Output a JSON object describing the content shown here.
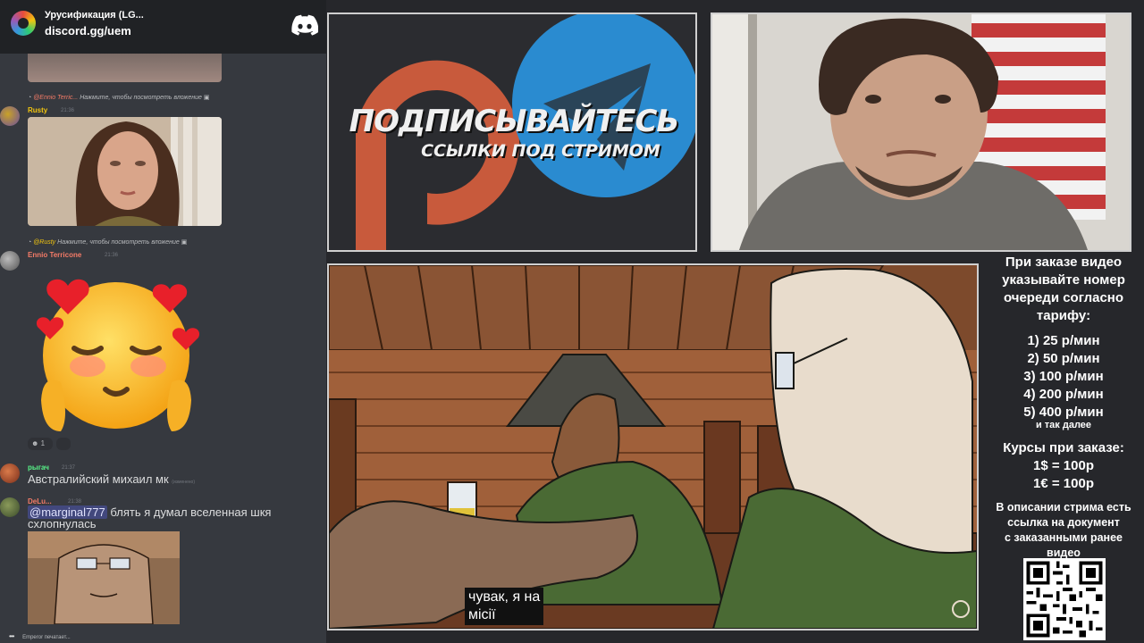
{
  "chat": {
    "server_name": "Урусификация (LG...",
    "server_invite": "discord.gg/uem",
    "messages": [
      {
        "reply_to_name": "@Ennio Terric...",
        "reply_text": "Нажмите, чтобы посмотреть вложение",
        "author": "Rusty",
        "time": "21:36",
        "author_color": "#f1c40f"
      },
      {
        "reply_to_name": "@Rusty",
        "reply_text": "Нажмите, чтобы посмотреть вложение",
        "author": "Ennio Terricone",
        "time": "21:36",
        "author_color": "#f47b67",
        "reaction_count": "1"
      },
      {
        "author": "рыгач",
        "time": "21:37",
        "text": "Австралийский михаил мк",
        "edited": "(изменено)",
        "author_color": "#57f287"
      },
      {
        "author": "DeLu...",
        "time": "21:38",
        "mention": "@marginal777",
        "text": "блять я думал вселенная шкя",
        "text2": "схлопнулась",
        "author_color": "#f47b67"
      }
    ],
    "typing": "Emperor печатает..."
  },
  "promo": {
    "title": "ПОДПИСЫВАЙТЕСЬ",
    "subtitle": "ССЫЛКИ ПОД СТРИМОМ",
    "patreon_color": "#c85a3c",
    "telegram_color": "#2a8bd0"
  },
  "video": {
    "subtitle_line1": "чувак, я на",
    "subtitle_line2": "місії"
  },
  "info": {
    "header": [
      "При заказе видео",
      "указывайте номер",
      "очереди согласно",
      "тарифу:"
    ],
    "tariffs": [
      "1) 25 р/мин",
      "2) 50 р/мин",
      "3) 100 р/мин",
      "4) 200 р/мин",
      "5) 400 р/мин"
    ],
    "tariff_more": "и так далее",
    "courses": [
      "Курсы при заказе:",
      "1$ = 100р",
      "1€ = 100р"
    ],
    "desc": [
      "В описании стрима есть",
      "ссылка на документ",
      "с заказанными ранее",
      "видео"
    ]
  }
}
